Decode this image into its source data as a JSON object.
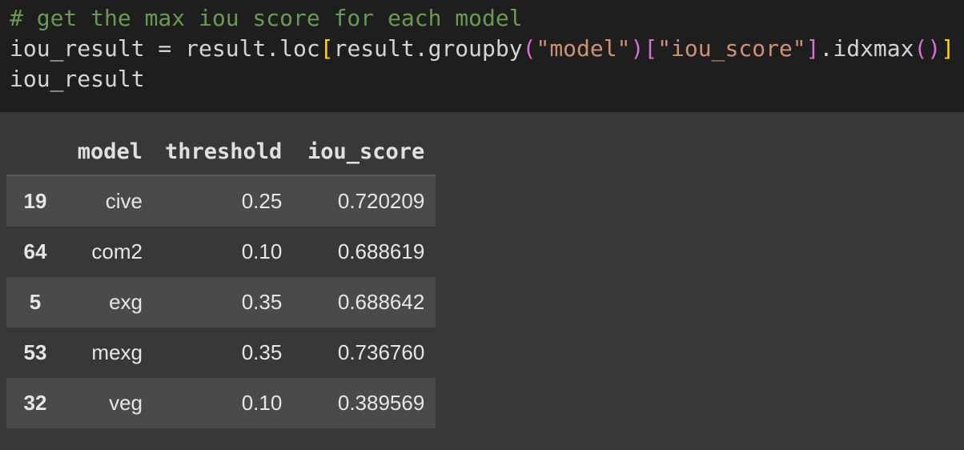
{
  "code": {
    "comment": "# get the max iou score for each model",
    "line2": {
      "a": "iou_result = result.loc",
      "b1": "[",
      "c": "result.groupby",
      "p1": "(",
      "s1": "\"model\"",
      "p2": ")",
      "b2": "[",
      "s2": "\"iou_score\"",
      "b3": "]",
      "d": ".idxmax",
      "p3": "()",
      "b4": "]"
    },
    "line3": "iou_result"
  },
  "table": {
    "index_header": "",
    "columns": [
      "model",
      "threshold",
      "iou_score"
    ],
    "rows": [
      {
        "index": "19",
        "model": "cive",
        "threshold": "0.25",
        "iou_score": "0.720209"
      },
      {
        "index": "64",
        "model": "com2",
        "threshold": "0.10",
        "iou_score": "0.688619"
      },
      {
        "index": "5",
        "model": "exg",
        "threshold": "0.35",
        "iou_score": "0.688642"
      },
      {
        "index": "53",
        "model": "mexg",
        "threshold": "0.35",
        "iou_score": "0.736760"
      },
      {
        "index": "32",
        "model": "veg",
        "threshold": "0.10",
        "iou_score": "0.389569"
      }
    ]
  }
}
